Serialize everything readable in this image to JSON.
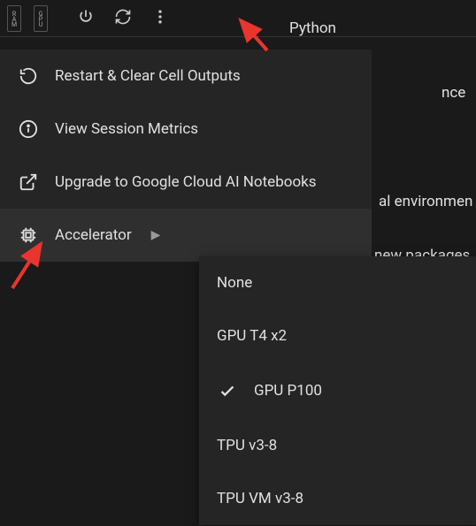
{
  "toolbar": {
    "ram_label": "RAM",
    "gpu_label": "GPU"
  },
  "header": {
    "python_label": "Python"
  },
  "bg_text": {
    "line1": "nce",
    "line2": "al environmen",
    "line3": "new packages"
  },
  "menu": {
    "restart": "Restart & Clear Cell Outputs",
    "metrics": "View Session Metrics",
    "upgrade": "Upgrade to Google Cloud AI Notebooks",
    "accelerator": "Accelerator"
  },
  "accelerator_options": {
    "none": "None",
    "gpu_t4": "GPU T4 x2",
    "gpu_p100": "GPU P100",
    "tpu_v3": "TPU v3-8",
    "tpu_vm": "TPU VM v3-8"
  }
}
